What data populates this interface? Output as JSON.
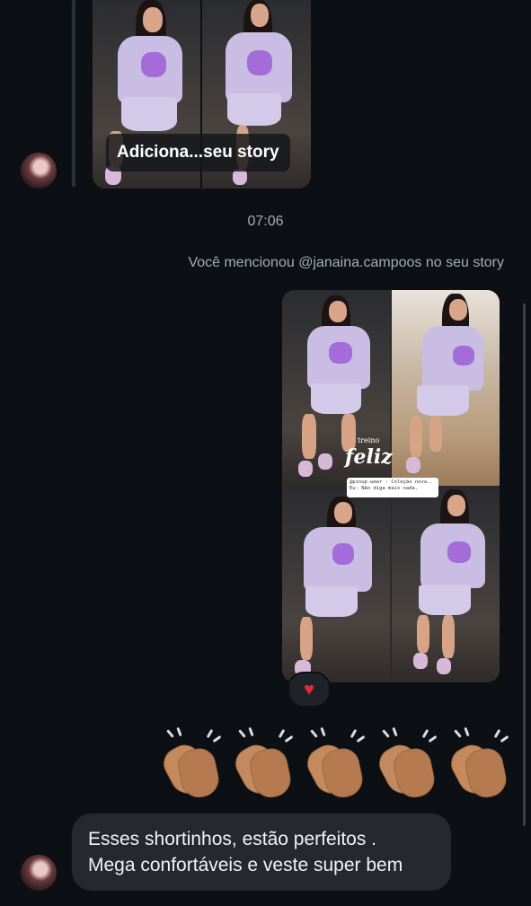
{
  "story_reply": {
    "label": "Adiciona...seu story"
  },
  "timestamp": "07:06",
  "mention_notice": "Você mencionou @janaina.campoos no seu story",
  "story_image": {
    "brand": "feliz",
    "brand_top": "treino",
    "caption": "@pinup.wear : Coleção nova.. Eu: Não diga mais nada."
  },
  "reaction": {
    "emoji": "♥",
    "color": "#e8293f"
  },
  "clap_emoji_count": 5,
  "message": {
    "line1": "Esses shortinhos, estão perfeitos .",
    "line2": "Mega confortáveis e veste super bem"
  },
  "colors": {
    "background": "#0c1014",
    "bubble": "#25292e",
    "muted_text": "#a8adb3"
  }
}
